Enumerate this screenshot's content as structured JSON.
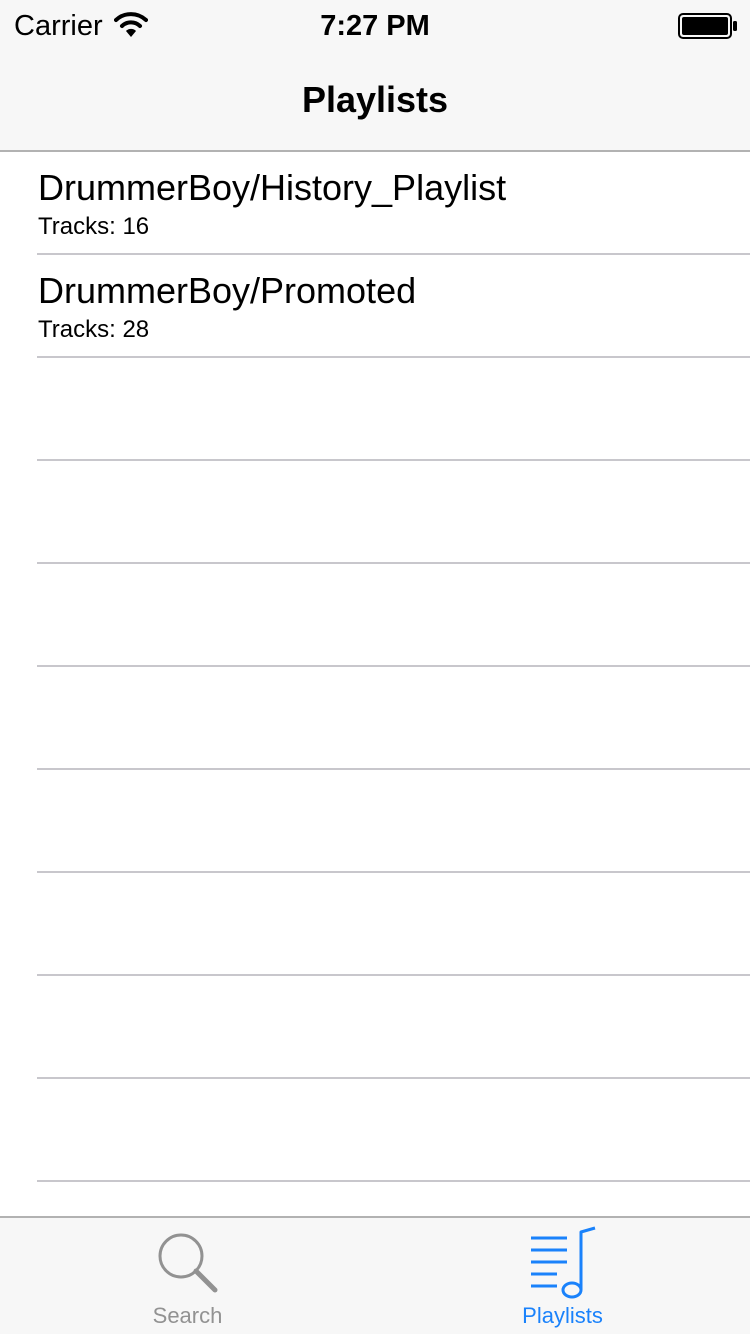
{
  "status_bar": {
    "carrier": "Carrier",
    "time": "7:27 PM",
    "icons": [
      "wifi-icon",
      "battery-icon"
    ]
  },
  "nav": {
    "title": "Playlists"
  },
  "playlists": [
    {
      "name": "DrummerBoy/History_Playlist",
      "tracks": "Tracks: 16"
    },
    {
      "name": "DrummerBoy/Promoted",
      "tracks": "Tracks: 28"
    }
  ],
  "tab_bar": {
    "tabs": [
      {
        "label": "Search",
        "icon": "search-icon",
        "selected": false
      },
      {
        "label": "Playlists",
        "icon": "playlist-icon",
        "selected": true
      }
    ]
  },
  "colors": {
    "accent": "#1a82fb",
    "inactive": "#929292",
    "bar_background": "#f7f7f7",
    "separator": "#c8c7cc"
  }
}
